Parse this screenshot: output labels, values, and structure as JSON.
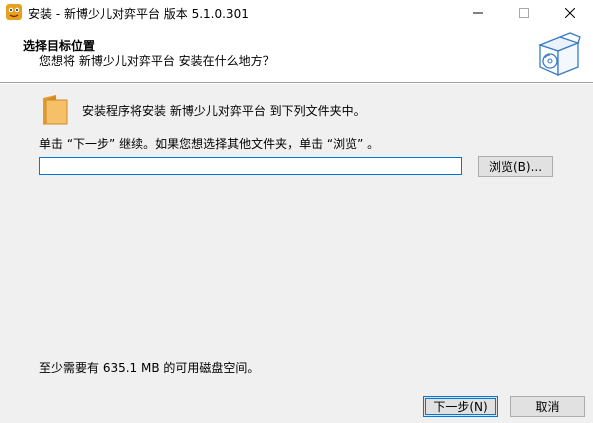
{
  "window": {
    "title": "安装 - 新博少儿对弈平台 版本 5.1.0.301",
    "controls": {
      "minimize_icon": "minimize-icon",
      "maximize_icon": "maximize-icon",
      "close_icon": "close-icon"
    }
  },
  "header": {
    "title": "选择目标位置",
    "subtitle": "您想将 新博少儿对弈平台 安装在什么地方？",
    "art_icon": "install-box-icon"
  },
  "main": {
    "folder_icon": "folder-icon",
    "install_message": "安装程序将安装 新博少儿对弈平台 到下列文件夹中。",
    "instruction": "单击 “下一步” 继续。如果您想选择其他文件夹，单击 “浏览” 。",
    "path_value": "",
    "browse_label": "浏览(B)...",
    "space_message": "至少需要有 635.1 MB 的可用磁盘空间。"
  },
  "footer": {
    "next_label": "下一步(N)",
    "cancel_label": "取消"
  },
  "colors": {
    "accent": "#0078d7",
    "panel": "#f0f0f0",
    "folder": "#f0b44c"
  }
}
